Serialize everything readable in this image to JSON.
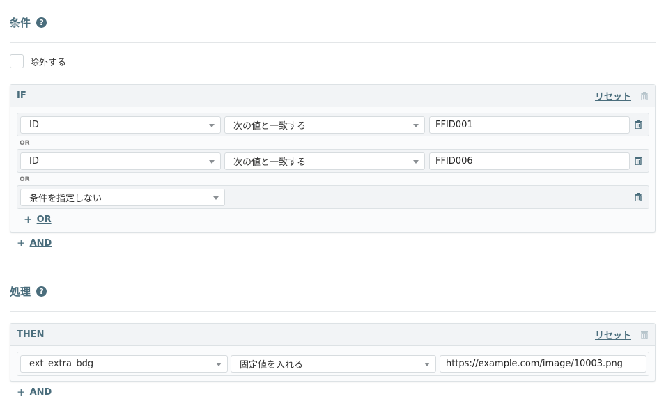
{
  "conditions": {
    "title": "条件",
    "help_icon": "?",
    "exclude_label": "除外する",
    "if_panel": {
      "label": "IF",
      "reset_label": "リセット",
      "rows": [
        {
          "field": "ID",
          "operator": "次の値と一致する",
          "value": "FFID001"
        },
        {
          "field": "ID",
          "operator": "次の値と一致する",
          "value": "FFID006"
        },
        {
          "field": "条件を指定しない"
        }
      ],
      "or_separator": "OR",
      "add_or_label": "OR"
    },
    "add_and_label": "AND"
  },
  "processing": {
    "title": "処理",
    "help_icon": "?",
    "then_panel": {
      "label": "THEN",
      "reset_label": "リセット",
      "row": {
        "field": "ext_extra_bdg",
        "operator": "固定値を入れる",
        "value": "https://example.com/image/10003.png"
      }
    },
    "add_and_label": "AND"
  },
  "colors": {
    "accent": "#4a6d7c",
    "border": "#dde2e5",
    "panel_head": "#f2f4f6"
  },
  "icons": {
    "trash": "trash-icon",
    "help": "help-icon",
    "plus": "plus-icon",
    "caret": "chevron-down-icon"
  }
}
